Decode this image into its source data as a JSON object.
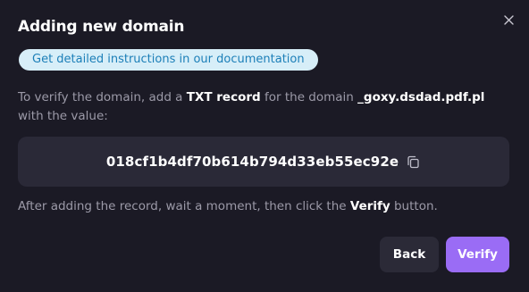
{
  "dialog": {
    "title": "Adding new domain",
    "doc_link_label": "Get detailed instructions in our documentation",
    "instructions": {
      "part1": "To verify the domain, add a ",
      "record_type": "TXT record",
      "part2": " for the domain ",
      "domain": "_goxy.dsdad.pdf.pl",
      "part3": " with the value:"
    },
    "value": "018cf1b4df70b614b794d33eb55ec92e",
    "after": {
      "part1": "After adding the record, wait a moment, then click the ",
      "button_ref": "Verify",
      "part2": " button."
    },
    "buttons": {
      "back_label": "Back",
      "verify_label": "Verify"
    }
  },
  "icons": {
    "close": "close-icon",
    "copy": "copy-icon"
  },
  "colors": {
    "background": "#1b1a25",
    "value_box": "#2a2937",
    "accent": "#9a6cf5",
    "link_bg": "#d7eef8",
    "link_text": "#1c7fb8",
    "muted_text": "#9c9aa8"
  }
}
